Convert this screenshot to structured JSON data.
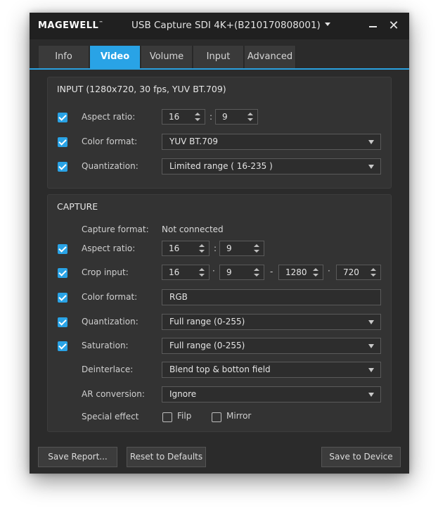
{
  "title_bar": {
    "brand": "MAGEWELL",
    "brand_tm": "™",
    "device": "USB Capture SDI 4K+(B210170808001)",
    "close_glyph": "✕"
  },
  "tabs": [
    {
      "label": "Info"
    },
    {
      "label": "Video",
      "active": true
    },
    {
      "label": "Volume"
    },
    {
      "label": "Input"
    },
    {
      "label": "Advanced"
    }
  ],
  "input": {
    "title": "INPUT (1280x720, 30 fps, YUV BT.709)",
    "aspect_ratio": {
      "label": "Aspect ratio:",
      "checked": true,
      "w": "16",
      "h": "9",
      "sep": ":"
    },
    "color_format": {
      "label": "Color format:",
      "checked": true,
      "value": "YUV BT.709"
    },
    "quantization": {
      "label": "Quantization:",
      "checked": true,
      "value": "Limited range ( 16-235 )"
    }
  },
  "capture": {
    "title": "CAPTURE",
    "capture_format": {
      "label": "Capture format:",
      "value": "Not connected"
    },
    "aspect_ratio": {
      "label": "Aspect ratio:",
      "checked": true,
      "w": "16",
      "h": "9",
      "sep": ":"
    },
    "crop_input": {
      "label": "Crop input:",
      "checked": true,
      "x": "16",
      "y": "9",
      "width": "1280",
      "height": "720",
      "sep_comma": "·",
      "sep_dash": "-"
    },
    "color_format": {
      "label": "Color format:",
      "checked": true,
      "value": "RGB"
    },
    "quantization": {
      "label": "Quantization:",
      "checked": true,
      "value": "Full range (0-255)"
    },
    "saturation": {
      "label": "Saturation:",
      "checked": true,
      "value": "Full range (0-255)"
    },
    "deinterlace": {
      "label": "Deinterlace:",
      "value": "Blend top & botton field"
    },
    "ar_conversion": {
      "label": "AR conversion:",
      "value": "Ignore"
    },
    "special_effect": {
      "label": "Special effect",
      "flip": {
        "label": "Filp",
        "checked": false
      },
      "mirror": {
        "label": "Mirror",
        "checked": false
      }
    }
  },
  "footer": {
    "save_report": "Save Report...",
    "reset_defaults": "Reset to Defaults",
    "save_device": "Save to Device"
  },
  "colors": {
    "accent": "#29a3e6",
    "window_bg": "#2b2b2b",
    "titlebar_bg": "#202020",
    "group_bg": "#333333"
  }
}
